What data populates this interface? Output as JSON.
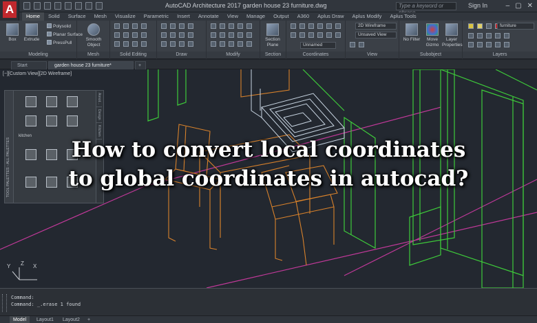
{
  "titlebar": {
    "app_icon_letter": "A",
    "window_title": "AutoCAD Architecture 2017   garden house 23 furniture.dwg",
    "search_placeholder": "Type a keyword or phrase",
    "sign_in": "Sign In",
    "window_controls": [
      "‒",
      "▢",
      "✕"
    ]
  },
  "ribbon_tabs": [
    "Home",
    "Solid",
    "Surface",
    "Mesh",
    "Visualize",
    "Parametric",
    "Insert",
    "Annotate",
    "View",
    "Manage",
    "Output",
    "A360",
    "Aplus Draw",
    "Aplus Modify",
    "Aplus Tools"
  ],
  "ribbon_active_tab": "Home",
  "modeling": {
    "box": "Box",
    "extrude": "Extrude",
    "polysolid": "Polysolid",
    "planar_surface": "Planar Surface",
    "presspull": "PressPull",
    "label": "Modeling"
  },
  "mesh": {
    "smooth_object": "Smooth Object",
    "label": "Mesh"
  },
  "solid_editing": {
    "label": "Solid Editing"
  },
  "draw": {
    "label": "Draw"
  },
  "modify": {
    "label": "Modify"
  },
  "section": {
    "section_plane": "Section Plane",
    "label": "Section"
  },
  "coordinates": {
    "unnamed": "Unnamed",
    "label": "Coordinates"
  },
  "view": {
    "visual_style": "2D Wireframe",
    "saved_view": "Unsaved View",
    "label": "View"
  },
  "subobject": {
    "no_filter": "No Filter",
    "move_gizmo": "Move Gizmo",
    "label": "Subobject"
  },
  "layers": {
    "layer_properties": "Layer Properties",
    "current_layer": "furniture",
    "label": "Layers"
  },
  "document_tabs": [
    {
      "label": "Start",
      "active": false
    },
    {
      "label": "garden house 23 furniture*",
      "active": true
    }
  ],
  "document_tabs_add": "+",
  "viewport": {
    "label": "[−][Custom View][2D Wireframe]",
    "ucs_y": "Y",
    "ucs_z": "Z",
    "ucs_x": "X"
  },
  "tool_palette": {
    "side_title": "TOOL PALETTES - ALL PALETTES",
    "side_tabs": [
      "Annot...",
      "Design",
      "Kitchen"
    ],
    "section_label": "kitchen"
  },
  "headline": {
    "line1": "How to convert local coordinates",
    "line2": "to global coordinates in autocad?"
  },
  "command_line": {
    "line1": "Command:",
    "line2": "Command:  _.erase 1 found"
  },
  "layout_tabs": [
    "Model",
    "Layout1",
    "Layout2"
  ],
  "layout_tabs_add": "+",
  "colors": {
    "wire_green": "#3ecb3a",
    "wire_orange": "#d9822b",
    "wire_magenta": "#c2399a",
    "wire_white": "#c9d6e3",
    "viewport_bg": "#232830",
    "ribbon_bg": "#3b4047",
    "acad_red": "#c0282d"
  }
}
